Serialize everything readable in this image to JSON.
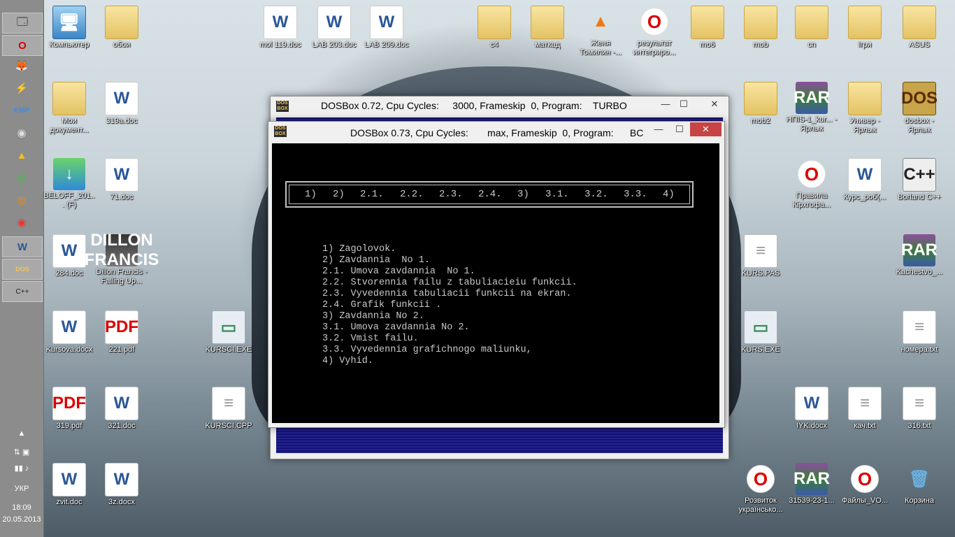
{
  "taskbar": {
    "tray_lang": "УКР",
    "tray_time": "18:09",
    "tray_date": "20.05.2013",
    "tray_up_arrow": "▲"
  },
  "desktop_icons": [
    {
      "label": "Компьютер",
      "icon": "computer-icon",
      "glyph": "🖥"
    },
    {
      "label": "обои",
      "icon": "folder-icon",
      "glyph": ""
    },
    {
      "label": "mol 119.doc",
      "icon": "word-icon",
      "glyph": "W"
    },
    {
      "label": "LAB 203.doc",
      "icon": "word-icon",
      "glyph": "W"
    },
    {
      "label": "LAB 209.doc",
      "icon": "word-icon",
      "glyph": "W"
    },
    {
      "label": "c4",
      "icon": "folder-icon",
      "glyph": ""
    },
    {
      "label": "маткад",
      "icon": "folder-icon",
      "glyph": ""
    },
    {
      "label": "Женя Томилин -...",
      "icon": "vlc-icon",
      "glyph": "▲"
    },
    {
      "label": "результат интегриро...",
      "icon": "opera-icon",
      "glyph": "O"
    },
    {
      "label": "mo6",
      "icon": "folder-icon",
      "glyph": ""
    },
    {
      "label": "mob",
      "icon": "folder-icon",
      "glyph": ""
    },
    {
      "label": "cn",
      "icon": "folder-icon",
      "glyph": ""
    },
    {
      "label": "Ігри",
      "icon": "folder-icon",
      "glyph": ""
    },
    {
      "label": "ASUS",
      "icon": "folder-icon",
      "glyph": ""
    },
    {
      "label": "Мои документ...",
      "icon": "folder-icon",
      "glyph": ""
    },
    {
      "label": "319a.doc",
      "icon": "word-icon",
      "glyph": "W"
    },
    {
      "label": "mob2",
      "icon": "folder-icon",
      "glyph": ""
    },
    {
      "label": "НПІS-1_kur... - Ярлык",
      "icon": "rar-icon",
      "glyph": "RAR"
    },
    {
      "label": "Универ - Ярлык",
      "icon": "folder-icon",
      "glyph": ""
    },
    {
      "label": "dosbox - Ярлык",
      "icon": "dosbox-icon",
      "glyph": "DOS"
    },
    {
      "label": "BELOFF_201... (F)",
      "icon": "install-icon",
      "glyph": "↓"
    },
    {
      "label": "71.doc",
      "icon": "word-icon",
      "glyph": "W"
    },
    {
      "label": "Правила Кірхгофа...",
      "icon": "opera-icon",
      "glyph": "O"
    },
    {
      "label": "Курс_роб(...",
      "icon": "word-icon",
      "glyph": "W"
    },
    {
      "label": "Borland C++",
      "icon": "borland-icon",
      "glyph": "C++"
    },
    {
      "label": "284.doc",
      "icon": "word-icon",
      "glyph": "W"
    },
    {
      "label": "Dillon Francis - Falling Up...",
      "icon": "album-icon",
      "glyph": "DILLON FRANCIS"
    },
    {
      "label": "KURS.PAS",
      "icon": "notepad-icon",
      "glyph": "≡"
    },
    {
      "label": "Kachestvo_...",
      "icon": "rar-icon",
      "glyph": "RAR"
    },
    {
      "label": "Kursova.docx",
      "icon": "word-icon",
      "glyph": "W"
    },
    {
      "label": "221.pdf",
      "icon": "pdf-icon",
      "glyph": "PDF"
    },
    {
      "label": "KURSCI.EXE",
      "icon": "exe-icon",
      "glyph": "▭"
    },
    {
      "label": "KURS.EXE",
      "icon": "exe-icon",
      "glyph": "▭"
    },
    {
      "label": "номера.txt",
      "icon": "text-file-icon",
      "glyph": "≡"
    },
    {
      "label": "319.pdf",
      "icon": "pdf-icon",
      "glyph": "PDF"
    },
    {
      "label": "321.doc",
      "icon": "word-icon",
      "glyph": "W"
    },
    {
      "label": "KURSCI.CPP",
      "icon": "notepad-icon",
      "glyph": "≡"
    },
    {
      "label": "IYK.docx",
      "icon": "word-icon",
      "glyph": "W"
    },
    {
      "label": "кач.txt",
      "icon": "text-file-icon",
      "glyph": "≡"
    },
    {
      "label": "316.txt",
      "icon": "text-file-icon",
      "glyph": "≡"
    },
    {
      "label": "zvit.doc",
      "icon": "word-icon",
      "glyph": "W"
    },
    {
      "label": "3z.docx",
      "icon": "word-icon",
      "glyph": "W"
    },
    {
      "label": "Розвиток українсько...",
      "icon": "opera-icon",
      "glyph": "O"
    },
    {
      "label": "31539-23-1...",
      "icon": "rar-icon",
      "glyph": "RAR"
    },
    {
      "label": "Файлы_VO...",
      "icon": "opera-icon",
      "glyph": "O"
    },
    {
      "label": "Корзина",
      "icon": "recycle-bin-icon",
      "glyph": "🗑"
    }
  ],
  "window_back": {
    "title": "DOSBox 0.72, Cpu Cycles:     3000, Frameskip  0, Program:    TURBO",
    "app_icon": "DOS BOX",
    "min": "—",
    "max": "☐",
    "close": "✕"
  },
  "window_front": {
    "title": "DOSBox 0.73, Cpu Cycles:       max, Frameskip  0, Program:      BC",
    "app_icon": "DOS BOX",
    "min": "—",
    "max": "☐",
    "close": "✕",
    "menu": [
      "1)",
      "2)",
      "2.1.",
      "2.2.",
      "2.3.",
      "2.4.",
      "3)",
      "3.1.",
      "3.2.",
      "3.3.",
      "4)"
    ],
    "lines": [
      "1) Zagolovok.",
      "2) Zavdannia  No 1.",
      "2.1. Umova zavdannia  No 1.",
      "2.2. Stvorennia failu z tabuliacieiu funkcii.",
      "2.3. Vyvedennia tabuliacii funkcii na ekran.",
      "2.4. Grafik funkcii .",
      "3) Zavdannia No 2.",
      "3.1. Umova zavdannia No 2.",
      "3.2. Vmist failu.",
      "3.3. Vyvedennia grafichnogo maliunku,",
      "4) Vyhid."
    ]
  }
}
